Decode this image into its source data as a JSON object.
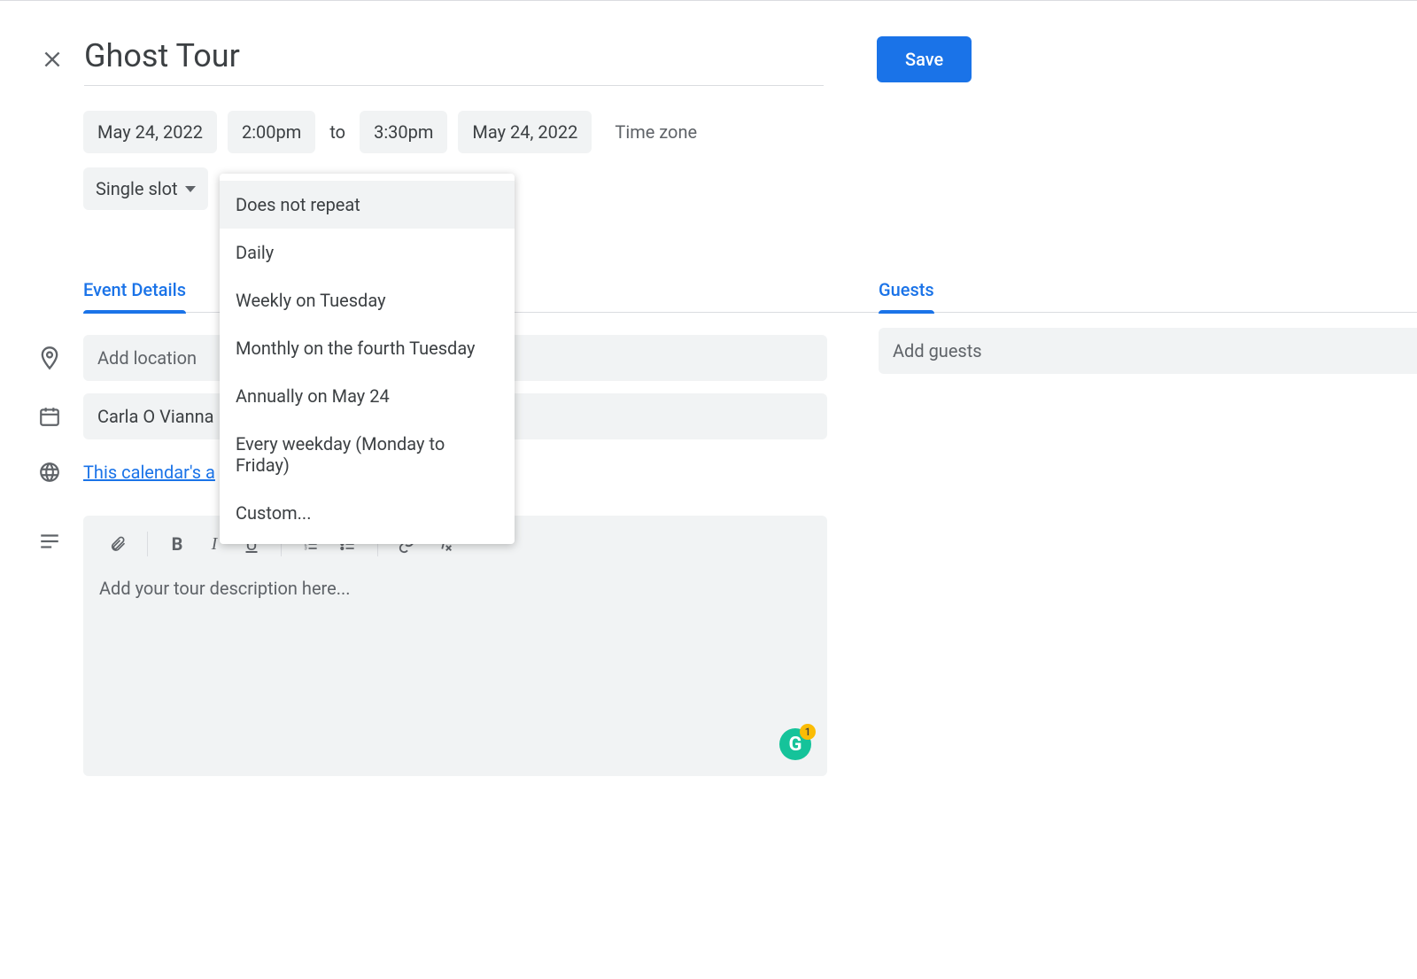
{
  "header": {
    "title": "Ghost Tour",
    "save_label": "Save"
  },
  "datetime": {
    "start_date": "May 24, 2022",
    "start_time": "2:00pm",
    "to_label": "to",
    "end_time": "3:30pm",
    "end_date": "May 24, 2022",
    "timezone_label": "Time zone"
  },
  "slot": {
    "label": "Single slot"
  },
  "repeat_dropdown": {
    "options": [
      "Does not repeat",
      "Daily",
      "Weekly on Tuesday",
      "Monthly on the fourth Tuesday",
      "Annually on May 24",
      "Every weekday (Monday to Friday)",
      "Custom..."
    ],
    "highlighted_index": 0
  },
  "tabs": {
    "event_details": "Event Details",
    "guests": "Guests"
  },
  "form": {
    "location_placeholder": "Add location",
    "organizer": "Carla O Vianna",
    "availability_link": "This calendar's a",
    "description_placeholder": "Add your tour description here...",
    "guests_placeholder": "Add guests"
  },
  "grammarly": {
    "letter": "G",
    "count": "1"
  }
}
